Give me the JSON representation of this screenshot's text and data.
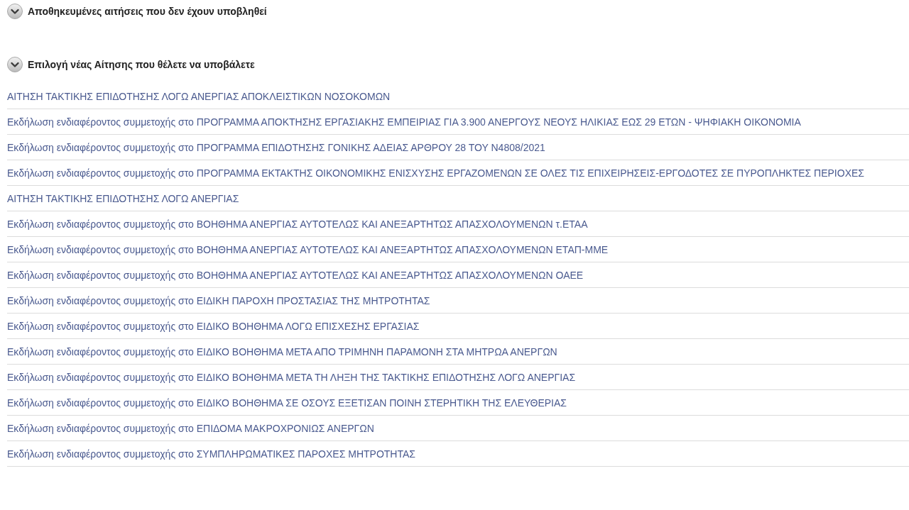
{
  "sections": [
    {
      "title": "Αποθηκευμένες αιτήσεις που δεν έχουν υποβληθεί"
    },
    {
      "title": "Επιλογή νέας Αίτησης που θέλετε να υποβάλετε",
      "items": [
        "ΑΙΤΗΣΗ ΤΑΚΤΙΚΗΣ ΕΠΙΔΟΤΗΣΗΣ ΛΟΓΩ ΑΝΕΡΓΙΑΣ ΑΠΟΚΛΕΙΣΤΙΚΩΝ ΝΟΣΟΚΟΜΩΝ",
        "Εκδήλωση ενδιαφέροντος συμμετοχής στο ΠΡΟΓΡΑΜΜΑ ΑΠΟΚΤΗΣΗΣ ΕΡΓΑΣΙΑΚΗΣ ΕΜΠΕΙΡΙΑΣ ΓΙΑ 3.900 ΑΝΕΡΓΟΥΣ ΝΕΟΥΣ ΗΛΙΚΙΑΣ ΕΩΣ 29 ΕΤΩΝ - ΨΗΦΙΑΚΗ ΟΙΚΟΝΟΜΙΑ",
        "Εκδήλωση ενδιαφέροντος συμμετοχής στο ΠΡΟΓΡΑΜΜΑ ΕΠΙΔΟΤΗΣΗΣ ΓΟΝΙΚΗΣ ΑΔΕΙΑΣ ΑΡΘΡΟΥ 28 ΤΟΥ Ν4808/2021",
        "Εκδήλωση ενδιαφέροντος συμμετοχής στο ΠΡΟΓΡΑΜΜΑ ΕΚΤΑΚΤΗΣ ΟΙΚΟΝΟΜΙΚΗΣ ΕΝΙΣΧΥΣΗΣ ΕΡΓΑΖΟΜΕΝΩΝ ΣΕ ΟΛΕΣ ΤΙΣ ΕΠΙΧΕΙΡΗΣΕΙΣ-ΕΡΓΟΔΟΤΕΣ ΣΕ ΠΥΡΟΠΛΗΚΤΕΣ ΠΕΡΙΟΧΕΣ",
        "ΑΙΤΗΣΗ ΤΑΚΤΙΚΗΣ ΕΠΙΔΟΤΗΣΗΣ ΛΟΓΩ ΑΝΕΡΓΙΑΣ",
        "Εκδήλωση ενδιαφέροντος συμμετοχής στο ΒΟΗΘΗΜΑ ΑΝΕΡΓΙΑΣ ΑΥΤΟΤΕΛΩΣ ΚΑΙ ΑΝΕΞΑΡΤΗΤΩΣ ΑΠΑΣΧΟΛΟΥΜΕΝΩΝ τ.ΕΤΑΑ",
        "Εκδήλωση ενδιαφέροντος συμμετοχής στο ΒΟΗΘΗΜΑ ΑΝΕΡΓΙΑΣ ΑΥΤΟΤΕΛΩΣ ΚΑΙ ΑΝΕΞΑΡΤΗΤΩΣ ΑΠΑΣΧΟΛΟΥΜΕΝΩΝ ΕΤΑΠ-ΜΜΕ",
        "Εκδήλωση ενδιαφέροντος συμμετοχής στο ΒΟΗΘΗΜΑ ΑΝΕΡΓΙΑΣ ΑΥΤΟΤΕΛΩΣ ΚΑΙ ΑΝΕΞΑΡΤΗΤΩΣ ΑΠΑΣΧΟΛΟΥΜΕΝΩΝ ΟΑΕΕ",
        "Εκδήλωση ενδιαφέροντος συμμετοχής στο ΕΙΔΙΚΗ ΠΑΡΟΧΗ ΠΡΟΣΤΑΣΙΑΣ ΤΗΣ ΜΗΤΡΟΤΗΤΑΣ",
        "Εκδήλωση ενδιαφέροντος συμμετοχής στο ΕΙΔΙΚΟ ΒΟΗΘΗΜΑ ΛΟΓΩ ΕΠΙΣΧΕΣΗΣ ΕΡΓΑΣΙΑΣ",
        "Εκδήλωση ενδιαφέροντος συμμετοχής στο ΕΙΔΙΚΟ ΒΟΗΘΗΜΑ ΜΕΤΑ ΑΠΟ ΤΡΙΜΗΝΗ ΠΑΡΑΜΟΝΗ ΣΤΑ ΜΗΤΡΩΑ ΑΝΕΡΓΩΝ",
        "Εκδήλωση ενδιαφέροντος συμμετοχής στο ΕΙΔΙΚΟ ΒΟΗΘΗΜΑ ΜΕΤΑ ΤΗ ΛΗΞΗ ΤΗΣ ΤΑΚΤΙΚΗΣ ΕΠΙΔΟΤΗΣΗΣ ΛΟΓΩ ΑΝΕΡΓΙΑΣ",
        "Εκδήλωση ενδιαφέροντος συμμετοχής στο ΕΙΔΙΚΟ ΒΟΗΘΗΜΑ ΣΕ ΟΣΟΥΣ ΕΞΕΤΙΣΑΝ ΠΟΙΝΗ ΣΤΕΡΗΤΙΚΗ ΤΗΣ ΕΛΕΥΘΕΡΙΑΣ",
        "Εκδήλωση ενδιαφέροντος συμμετοχής στο ΕΠΙΔΟΜΑ ΜΑΚΡΟΧΡΟΝΙΩΣ ΑΝΕΡΓΩΝ",
        "Εκδήλωση ενδιαφέροντος συμμετοχής στο ΣΥΜΠΛΗΡΩΜΑΤΙΚΕΣ ΠΑΡΟΧΕΣ ΜΗΤΡΟΤΗΤΑΣ"
      ]
    }
  ]
}
